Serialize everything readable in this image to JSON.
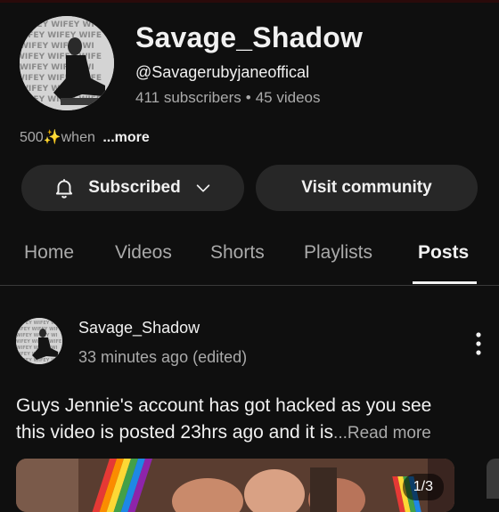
{
  "channel": {
    "name": "Savage_Shadow",
    "handle": "@Savagerubyjaneoffical",
    "subscribers": "411 subscribers",
    "separator": "•",
    "videos": "45 videos",
    "avatar_watermark": "WIFEY"
  },
  "description": {
    "prefix": "500",
    "star": "✨",
    "text": "when",
    "more_label": "...more"
  },
  "buttons": {
    "subscribed_label": "Subscribed",
    "community_label": "Visit community"
  },
  "tabs": [
    {
      "label": "Home"
    },
    {
      "label": "Videos"
    },
    {
      "label": "Shorts"
    },
    {
      "label": "Playlists"
    },
    {
      "label": "Posts",
      "active": true
    }
  ],
  "post": {
    "author": "Savage_Shadow",
    "time": "33 minutes ago (edited)",
    "text_line1": "Guys Jennie's account has got hacked as you see",
    "text_line2": "this video is posted 23hrs ago and it is",
    "read_more": "...Read more",
    "image_counter": "1/3"
  },
  "icons": {
    "subscribed": "bell-icon",
    "dropdown": "chevron-down-icon",
    "options": "more-vert-icon"
  },
  "colors": {
    "background": "#0f0f0f",
    "button_bg": "#272727",
    "text_primary": "#f1f1f1",
    "text_secondary": "#aaaaaa"
  }
}
